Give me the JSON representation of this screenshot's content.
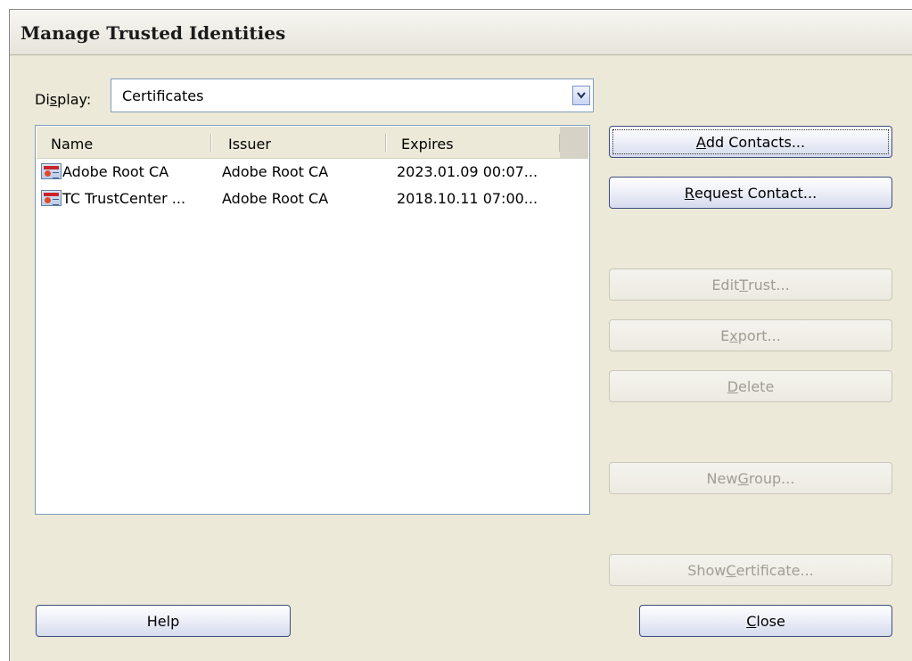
{
  "window": {
    "title": "Manage Trusted Identities"
  },
  "display": {
    "label_pre": "Di",
    "label_u": "s",
    "label_post": "play:",
    "selected": "Certificates",
    "dropdown_icon": "chevron-down-icon"
  },
  "list": {
    "columns": [
      "Name",
      "Issuer",
      "Expires"
    ],
    "rows": [
      {
        "name": "Adobe Root CA",
        "issuer": "Adobe Root CA",
        "expires": "2023.01.09 00:07...",
        "icon": "certificate-icon"
      },
      {
        "name": "TC TrustCenter ...",
        "issuer": "Adobe Root CA",
        "expires": "2018.10.11 07:00...",
        "icon": "certificate-icon"
      }
    ]
  },
  "buttons": {
    "add_contacts": {
      "pre": "",
      "u": "A",
      "post": "dd Contacts..."
    },
    "request_contact": {
      "pre": "",
      "u": "R",
      "post": "equest Contact..."
    },
    "edit_trust": {
      "pre": "Edit ",
      "u": "T",
      "post": "rust..."
    },
    "export": {
      "pre": "E",
      "u": "x",
      "post": "port..."
    },
    "delete": {
      "pre": "",
      "u": "D",
      "post": "elete"
    },
    "new_group": {
      "pre": "New ",
      "u": "G",
      "post": "roup..."
    },
    "show_certificate": {
      "pre": "Show ",
      "u": "C",
      "post": "ertificate..."
    },
    "help": {
      "label": "Help"
    },
    "close": {
      "pre": "",
      "u": "C",
      "post": "lose"
    }
  }
}
